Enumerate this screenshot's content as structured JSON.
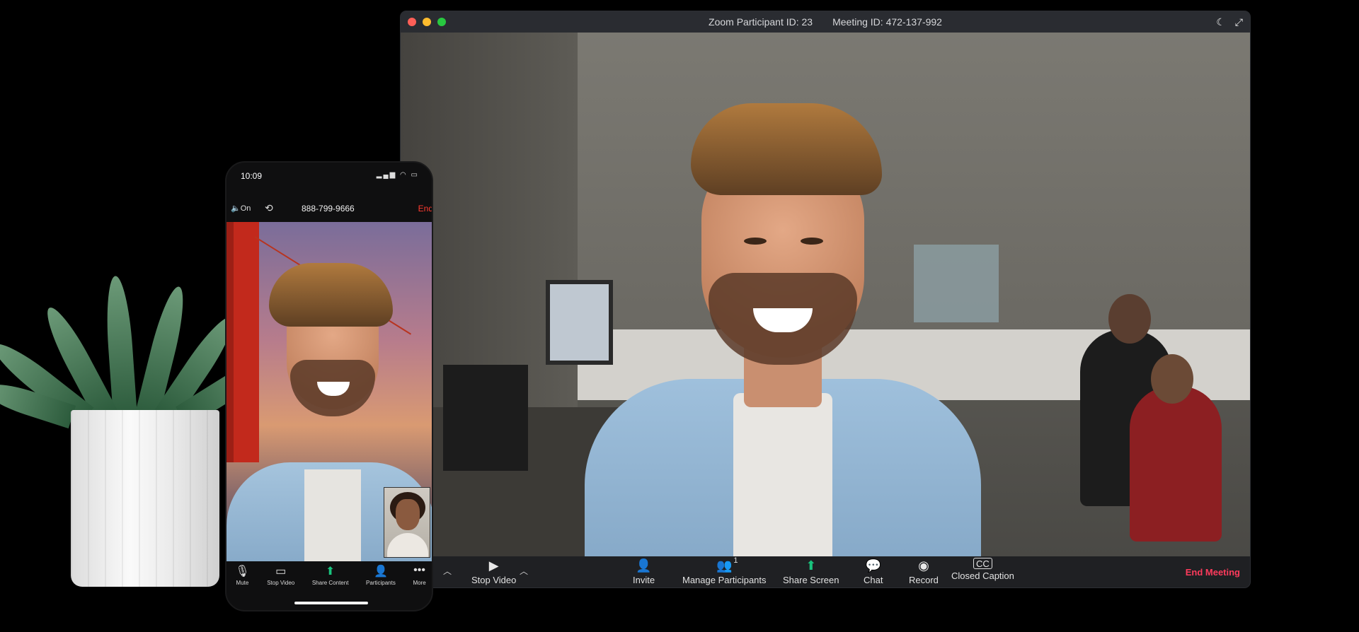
{
  "desktop": {
    "title": {
      "participant_id": "Zoom Participant ID: 23",
      "meeting_id": "Meeting ID: 472-137-992"
    },
    "toolbar": {
      "stop_video": "Stop Video",
      "invite": "Invite",
      "manage_participants": "Manage Participants",
      "participant_count": "1",
      "share_screen": "Share Screen",
      "chat": "Chat",
      "record": "Record",
      "closed_caption": "Closed Caption",
      "end_meeting": "End Meeting"
    },
    "colors": {
      "end_meeting": "#ff3b5c",
      "share_green": "#19c37d",
      "titlebar": "#2a2c31",
      "toolbar": "#1f2023"
    }
  },
  "phone": {
    "status": {
      "time": "10:09"
    },
    "header": {
      "speaker": "On",
      "number": "888-799-9666",
      "end": "End"
    },
    "toolbar": {
      "mute": "Mute",
      "stop_video": "Stop Video",
      "share_content": "Share Content",
      "participants": "Participants",
      "more": "More"
    }
  },
  "icons": {
    "traffic_close": "close-dot",
    "traffic_min": "minimize-dot",
    "traffic_max": "maximize-dot",
    "night": "crescent-moon-icon",
    "fullscreen": "fullscreen-icon",
    "video": "video-camera-icon",
    "invite": "add-user-icon",
    "participants": "users-icon",
    "share": "share-screen-icon",
    "chat": "chat-bubble-icon",
    "record": "record-icon",
    "cc": "closed-caption-icon"
  }
}
